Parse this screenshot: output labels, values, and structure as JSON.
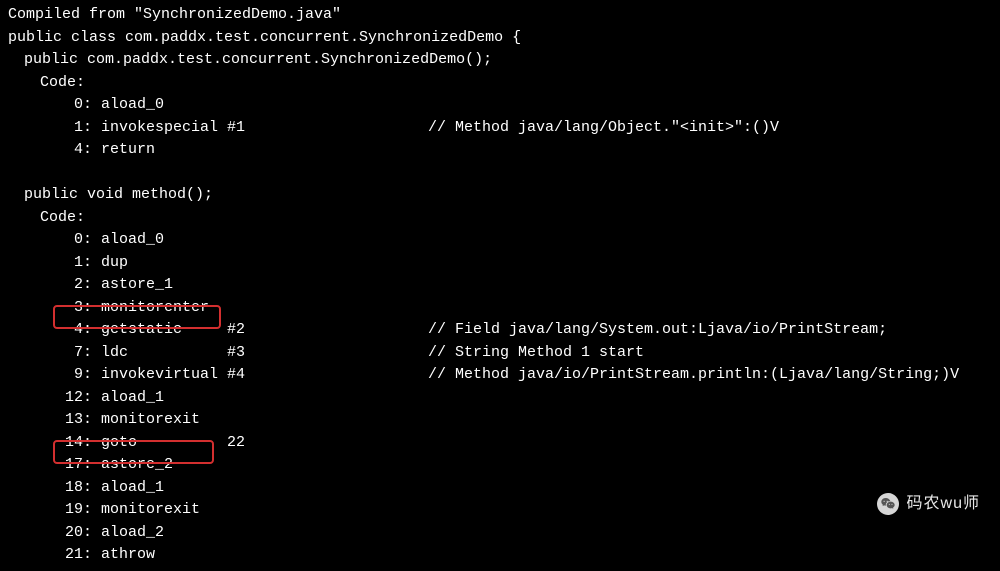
{
  "header": {
    "compiled_from": "Compiled from \"SynchronizedDemo.java\"",
    "class_decl": "public class com.paddx.test.concurrent.SynchronizedDemo {",
    "constructor_decl": "public com.paddx.test.concurrent.SynchronizedDemo();",
    "code_label": "Code:",
    "method_decl": "public void method();"
  },
  "constructor_code": [
    {
      "offset": "0:",
      "instr": "aload_0",
      "operand": "",
      "comment": ""
    },
    {
      "offset": "1:",
      "instr": "invokespecial",
      "operand": "#1",
      "comment": "// Method java/lang/Object.\"<init>\":()V"
    },
    {
      "offset": "4:",
      "instr": "return",
      "operand": "",
      "comment": ""
    }
  ],
  "method_code": [
    {
      "offset": "0:",
      "instr": "aload_0",
      "operand": "",
      "comment": ""
    },
    {
      "offset": "1:",
      "instr": "dup",
      "operand": "",
      "comment": ""
    },
    {
      "offset": "2:",
      "instr": "astore_1",
      "operand": "",
      "comment": ""
    },
    {
      "offset": "3:",
      "instr": "monitorenter",
      "operand": "",
      "comment": ""
    },
    {
      "offset": "4:",
      "instr": "getstatic",
      "operand": "#2",
      "comment": "// Field java/lang/System.out:Ljava/io/PrintStream;"
    },
    {
      "offset": "7:",
      "instr": "ldc",
      "operand": "#3",
      "comment": "// String Method 1 start"
    },
    {
      "offset": "9:",
      "instr": "invokevirtual",
      "operand": "#4",
      "comment": "// Method java/io/PrintStream.println:(Ljava/lang/String;)V"
    },
    {
      "offset": "12:",
      "instr": "aload_1",
      "operand": "",
      "comment": ""
    },
    {
      "offset": "13:",
      "instr": "monitorexit",
      "operand": "",
      "comment": ""
    },
    {
      "offset": "14:",
      "instr": "goto",
      "operand": "22",
      "comment": ""
    },
    {
      "offset": "17:",
      "instr": "astore_2",
      "operand": "",
      "comment": ""
    },
    {
      "offset": "18:",
      "instr": "aload_1",
      "operand": "",
      "comment": ""
    },
    {
      "offset": "19:",
      "instr": "monitorexit",
      "operand": "",
      "comment": ""
    },
    {
      "offset": "20:",
      "instr": "aload_2",
      "operand": "",
      "comment": ""
    },
    {
      "offset": "21:",
      "instr": "athrow",
      "operand": "",
      "comment": ""
    }
  ],
  "watermark": {
    "text": "码农wu师"
  },
  "colors": {
    "bg": "#000000",
    "fg": "#ffffff",
    "highlight_border": "#d32f2f"
  }
}
